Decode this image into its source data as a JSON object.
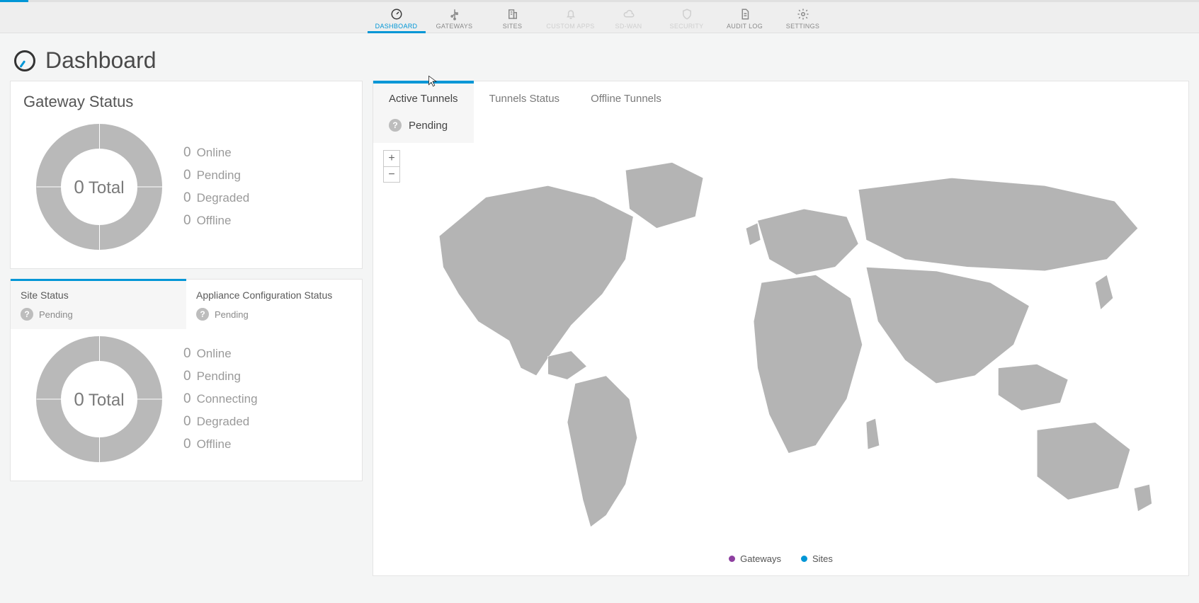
{
  "nav": {
    "items": [
      {
        "label": "DASHBOARD",
        "icon": "gauge",
        "active": true,
        "disabled": false
      },
      {
        "label": "GATEWAYS",
        "icon": "usb",
        "active": false,
        "disabled": false
      },
      {
        "label": "SITES",
        "icon": "building",
        "active": false,
        "disabled": false
      },
      {
        "label": "CUSTOM APPS",
        "icon": "bell",
        "active": false,
        "disabled": true
      },
      {
        "label": "SD-WAN",
        "icon": "cloud",
        "active": false,
        "disabled": true
      },
      {
        "label": "SECURITY",
        "icon": "shield",
        "active": false,
        "disabled": true
      },
      {
        "label": "AUDIT LOG",
        "icon": "doc",
        "active": false,
        "disabled": false
      },
      {
        "label": "SETTINGS",
        "icon": "gear",
        "active": false,
        "disabled": false
      }
    ]
  },
  "page": {
    "title": "Dashboard"
  },
  "gateway_status": {
    "title": "Gateway Status",
    "total_value": "0",
    "total_label": "Total",
    "legend": [
      {
        "value": "0",
        "label": "Online"
      },
      {
        "value": "0",
        "label": "Pending"
      },
      {
        "value": "0",
        "label": "Degraded"
      },
      {
        "value": "0",
        "label": "Offline"
      }
    ]
  },
  "site_status": {
    "tabs": [
      {
        "title": "Site Status",
        "pending": "Pending",
        "active": true
      },
      {
        "title": "Appliance Configuration Status",
        "pending": "Pending",
        "active": false
      }
    ],
    "total_value": "0",
    "total_label": "Total",
    "legend": [
      {
        "value": "0",
        "label": "Online"
      },
      {
        "value": "0",
        "label": "Pending"
      },
      {
        "value": "0",
        "label": "Connecting"
      },
      {
        "value": "0",
        "label": "Degraded"
      },
      {
        "value": "0",
        "label": "Offline"
      }
    ]
  },
  "tunnels": {
    "tabs": [
      {
        "label": "Active Tunnels",
        "active": true
      },
      {
        "label": "Tunnels Status",
        "active": false
      },
      {
        "label": "Offline Tunnels",
        "active": false
      }
    ],
    "pending": "Pending",
    "zoom": {
      "in": "+",
      "out": "−"
    },
    "legend": [
      {
        "label": "Gateways",
        "color": "purple"
      },
      {
        "label": "Sites",
        "color": "blue"
      }
    ]
  },
  "chart_data": [
    {
      "type": "pie",
      "title": "Gateway Status",
      "categories": [
        "Online",
        "Pending",
        "Degraded",
        "Offline"
      ],
      "values": [
        0,
        0,
        0,
        0
      ],
      "total": 0
    },
    {
      "type": "pie",
      "title": "Site Status",
      "categories": [
        "Online",
        "Pending",
        "Connecting",
        "Degraded",
        "Offline"
      ],
      "values": [
        0,
        0,
        0,
        0,
        0
      ],
      "total": 0
    }
  ]
}
